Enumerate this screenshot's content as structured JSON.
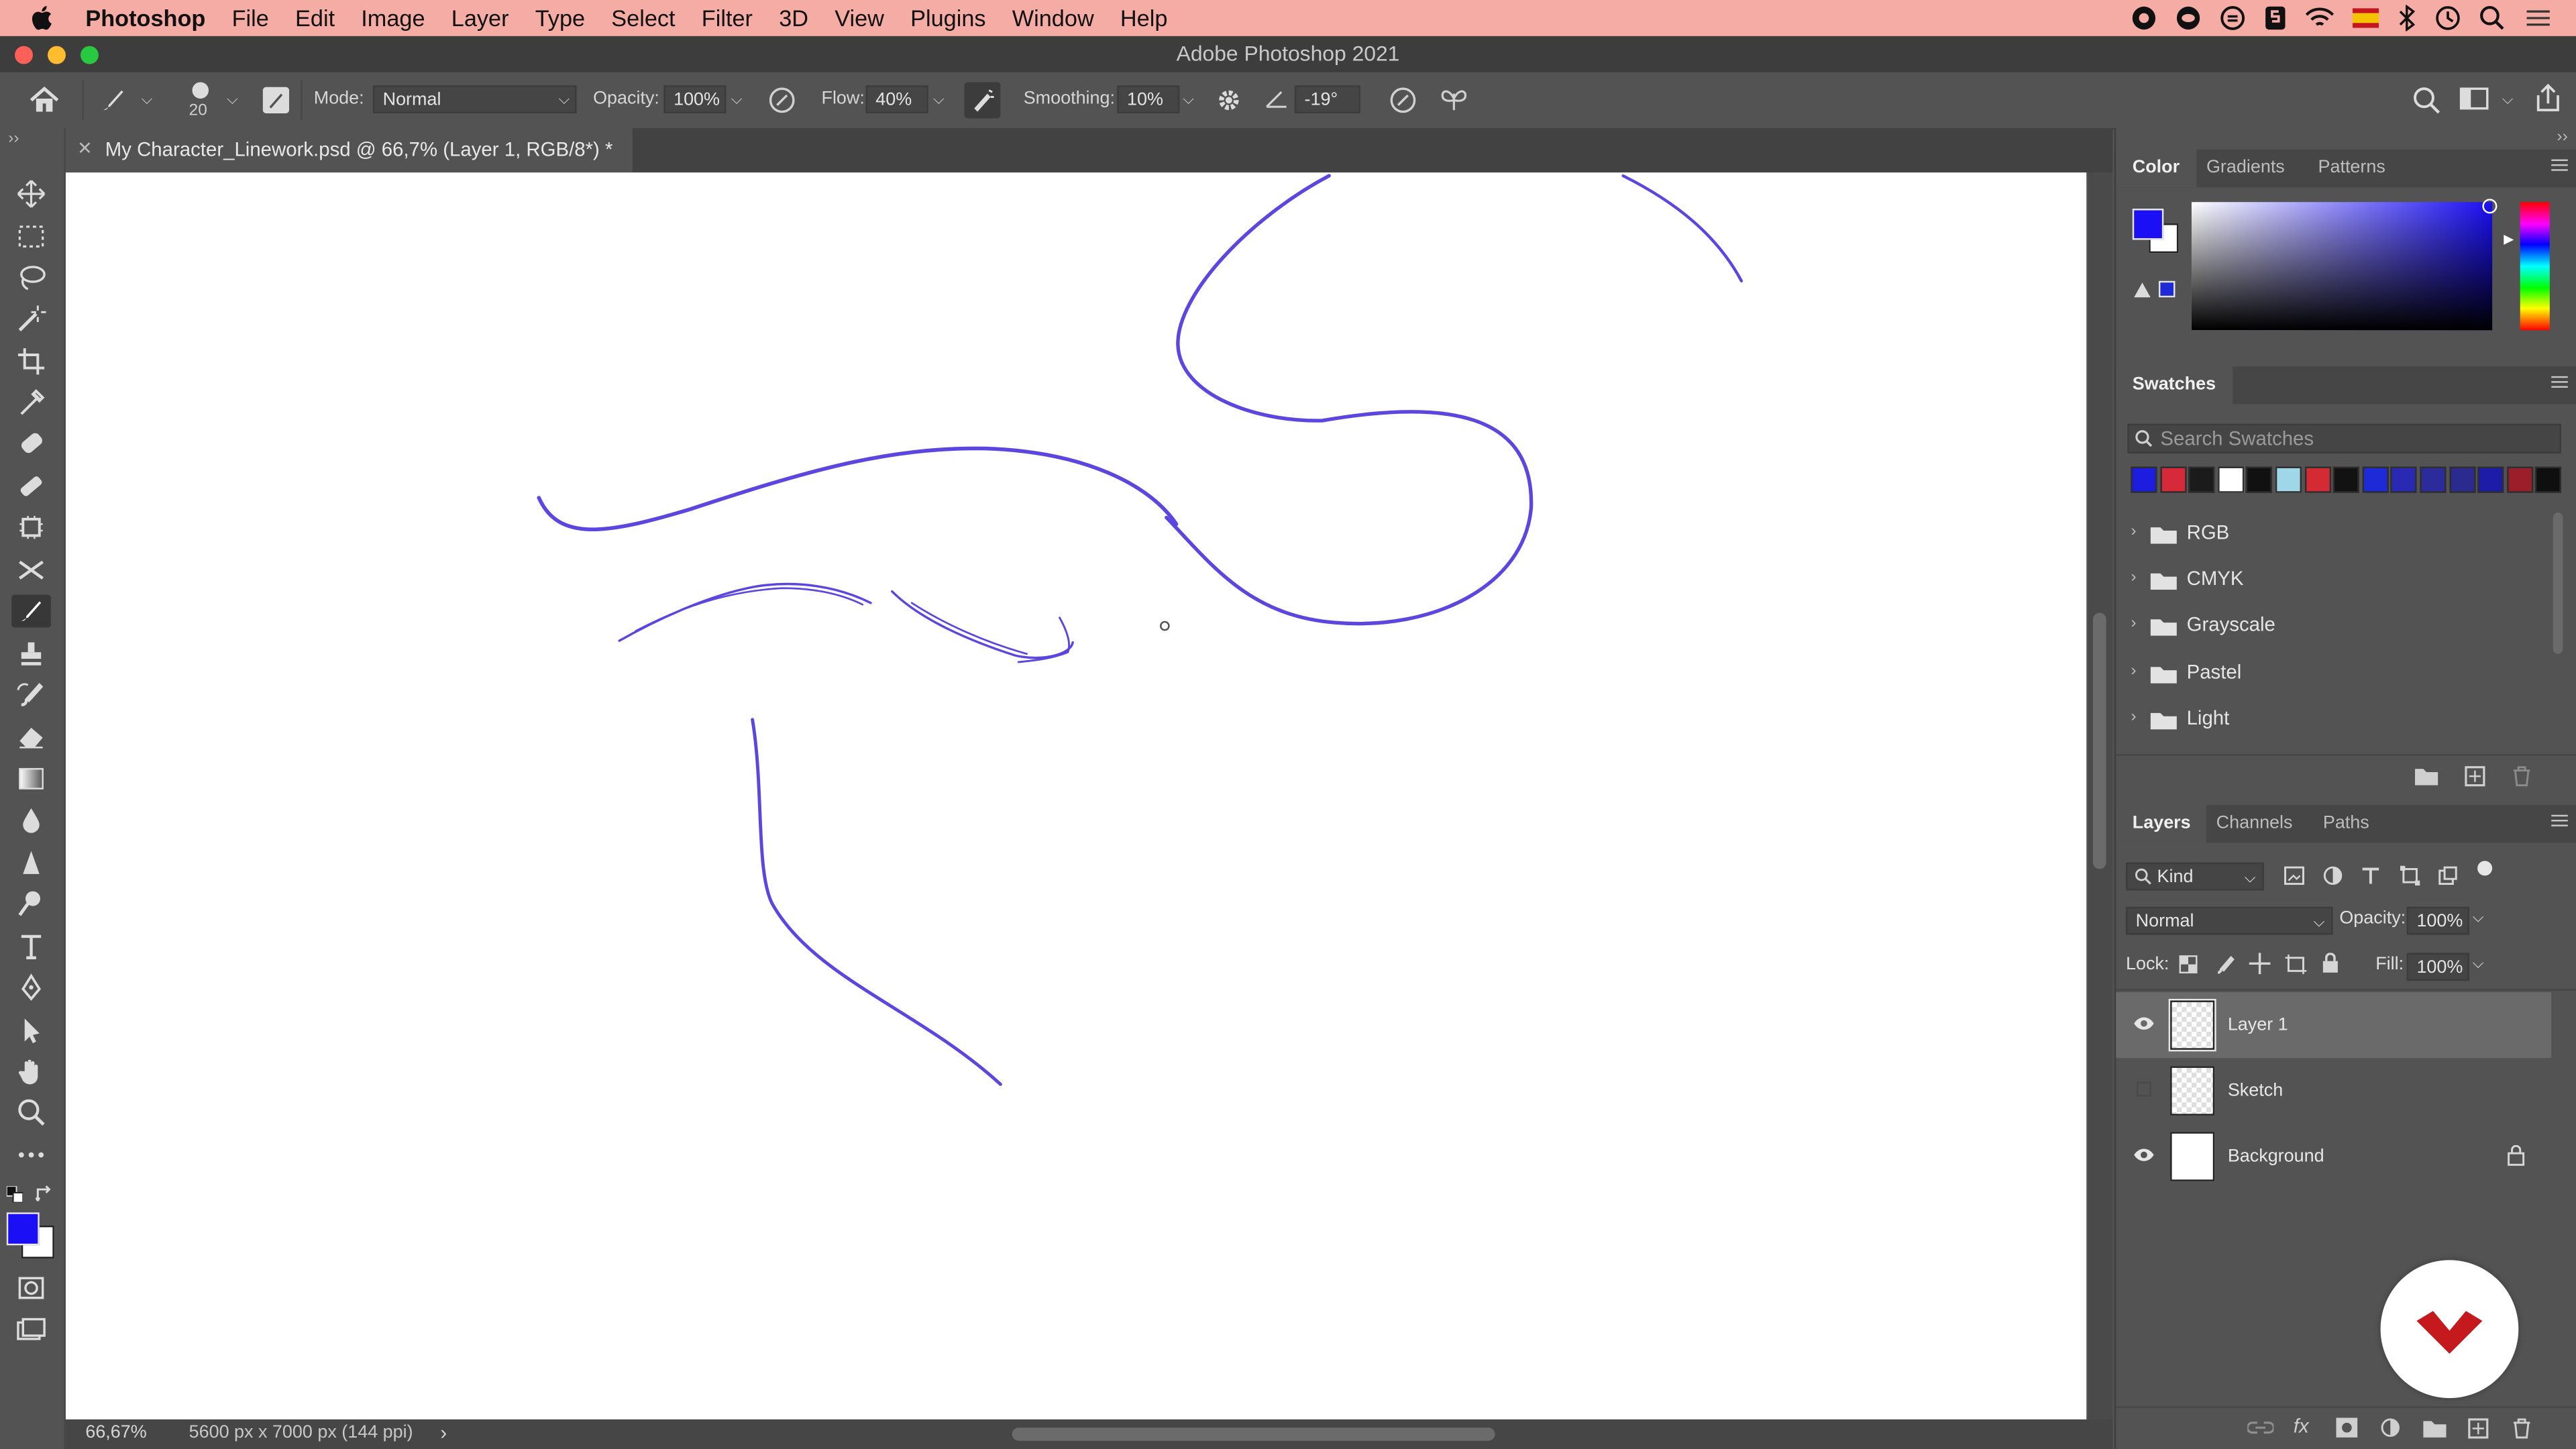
{
  "menubar": {
    "app_name": "Photoshop",
    "items": [
      "File",
      "Edit",
      "Image",
      "Layer",
      "Type",
      "Select",
      "Filter",
      "3D",
      "View",
      "Plugins",
      "Window",
      "Help"
    ],
    "status_icons": [
      "creative-cloud-icon",
      "creative-cloud-icon",
      "sync-icon",
      "shortcut-icon",
      "wifi-icon",
      "flag-icon",
      "bluetooth-icon",
      "time-machine-icon",
      "search-icon",
      "control-center-icon"
    ]
  },
  "window": {
    "title": "Adobe Photoshop 2021"
  },
  "options": {
    "brush_size": "20",
    "mode_label": "Mode:",
    "mode_value": "Normal",
    "opacity_label": "Opacity:",
    "opacity_value": "100%",
    "flow_label": "Flow:",
    "flow_value": "40%",
    "smoothing_label": "Smoothing:",
    "smoothing_value": "10%",
    "angle_value": "-19°"
  },
  "document": {
    "tab_title": "My Character_Linework.psd @ 66,7% (Layer 1, RGB/8*) *",
    "zoom": "66,67%",
    "size_info": "5600 px x 7000 px (144 ppi)"
  },
  "color_panel": {
    "tabs": [
      "Color",
      "Gradients",
      "Patterns"
    ],
    "foreground": "#1a0ff5",
    "background": "#ffffff"
  },
  "swatches_panel": {
    "title": "Swatches",
    "search_placeholder": "Search Swatches",
    "colors": [
      "#1d1ddf",
      "#d62a3a",
      "#1b1b1b",
      "#ffffff",
      "#111111",
      "#9fd6e8",
      "#d42a34",
      "#121212",
      "#1e2ad6",
      "#2929b3",
      "#2b2b9c",
      "#2a2a8f",
      "#1c1ca8",
      "#9a1f2a",
      "#0f0f0f"
    ],
    "groups": [
      "RGB",
      "CMYK",
      "Grayscale",
      "Pastel",
      "Light"
    ]
  },
  "layers_panel": {
    "tabs": [
      "Layers",
      "Channels",
      "Paths"
    ],
    "filter_kind": "Kind",
    "blend_mode": "Normal",
    "opacity_label": "Opacity:",
    "opacity_value": "100%",
    "lock_label": "Lock:",
    "fill_label": "Fill:",
    "fill_value": "100%",
    "layers": [
      {
        "name": "Layer 1",
        "visible": true,
        "selected": true,
        "locked": false
      },
      {
        "name": "Sketch",
        "visible": false,
        "selected": false,
        "locked": false
      },
      {
        "name": "Background",
        "visible": true,
        "selected": false,
        "locked": true
      }
    ]
  },
  "colors": {
    "stroke": "#5b46e0",
    "menubar_bg": "#f5aca4",
    "logo_red": "#c41a1e"
  }
}
